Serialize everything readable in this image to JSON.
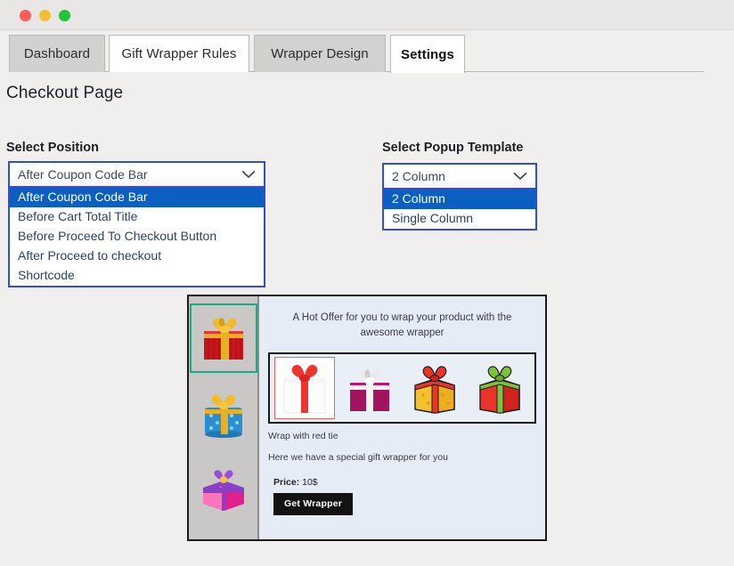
{
  "window": {
    "traffic_lights": [
      {
        "name": "close",
        "color": "#fc5c55"
      },
      {
        "name": "minimize",
        "color": "#f5bf35"
      },
      {
        "name": "maximize",
        "color": "#20c932"
      }
    ]
  },
  "tabs": [
    {
      "label": "Dashboard",
      "state": "inactive"
    },
    {
      "label": "Gift Wrapper Rules",
      "state": "hover"
    },
    {
      "label": "Wrapper Design",
      "state": "inactive"
    },
    {
      "label": "Settings",
      "state": "active"
    }
  ],
  "page": {
    "title": "Checkout Page"
  },
  "fields": {
    "position": {
      "label": "Select Position",
      "value": "After Coupon Code Bar",
      "open": true,
      "caret_icon": "chevron-down-icon",
      "options": [
        "After Coupon Code Bar",
        "Before Cart Total Title",
        "Before Proceed To Checkout Button",
        "After Proceed to checkout",
        "Shortcode"
      ],
      "selected_index": 0
    },
    "template": {
      "label": "Select Popup Template",
      "value": "2 Column",
      "open": true,
      "caret_icon": "chevron-down-icon",
      "options": [
        "2 Column",
        "Single Column"
      ],
      "selected_index": 0
    }
  },
  "preview": {
    "sidebar_thumbs": [
      {
        "name": "gift-red-gold",
        "selected": true
      },
      {
        "name": "gift-blue-gold",
        "selected": false
      },
      {
        "name": "gift-pink-purple",
        "selected": false
      }
    ],
    "offer_text": "A Hot Offer for you to wrap your product with the awesome wrapper",
    "wrappers": [
      {
        "name": "wrapper-white-red-ribbon",
        "selected": true
      },
      {
        "name": "wrapper-magenta-white-ribbon",
        "selected": false
      },
      {
        "name": "wrapper-yellow-red-ribbon",
        "selected": false
      },
      {
        "name": "wrapper-red-green-ribbon",
        "selected": false
      }
    ],
    "wrapper_name": "Wrap with red tie",
    "description": "Here we have a special gift wrapper for you",
    "price_label": "Price:",
    "price_value": "10$",
    "cta_label": "Get Wrapper"
  },
  "colors": {
    "accent_blue": "#2e4ddb",
    "highlight_blue": "#0b5fc0",
    "selection_teal": "#18ab86",
    "selection_red": "#e8635f",
    "panel_bg": "#e5ecf5",
    "page_bg": "#f0efee"
  }
}
